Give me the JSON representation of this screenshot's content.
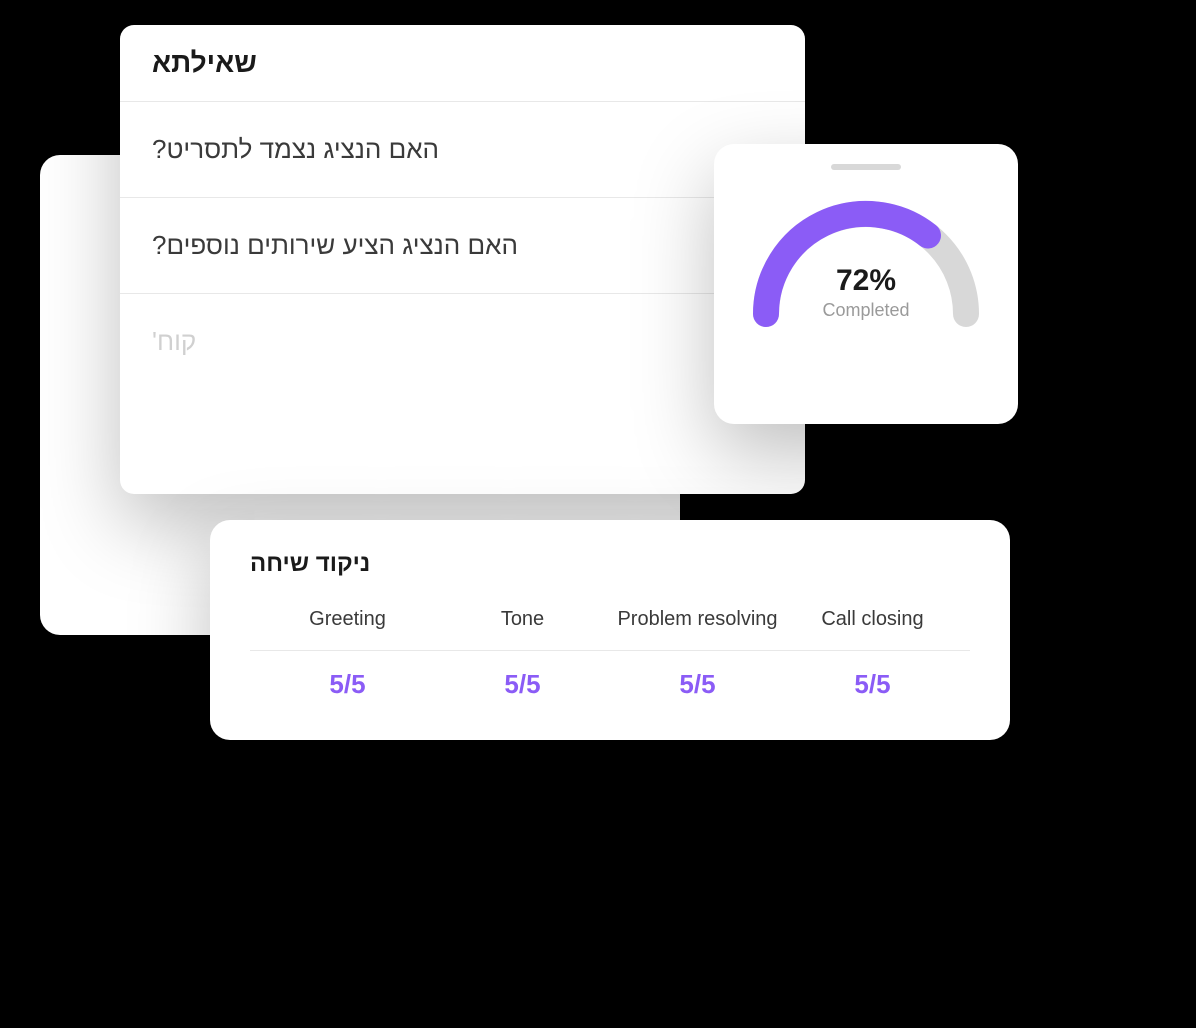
{
  "questions": {
    "title": "שאילתא",
    "items": [
      "האם הנציג נצמד לתסריט?",
      "האם הנציג הציע שירותים נוספים?"
    ],
    "faded_item": "קוח'"
  },
  "gauge": {
    "percent": "72%",
    "label": "Completed",
    "value": 72,
    "accent_color": "#8b5cf6",
    "track_color": "#d8d8d8"
  },
  "scores": {
    "title": "ניקוד שיחה",
    "columns": [
      {
        "label": "Greeting",
        "value": "5/5"
      },
      {
        "label": "Tone",
        "value": "5/5"
      },
      {
        "label": "Problem resolving",
        "value": "5/5"
      },
      {
        "label": "Call closing",
        "value": "5/5"
      }
    ]
  }
}
